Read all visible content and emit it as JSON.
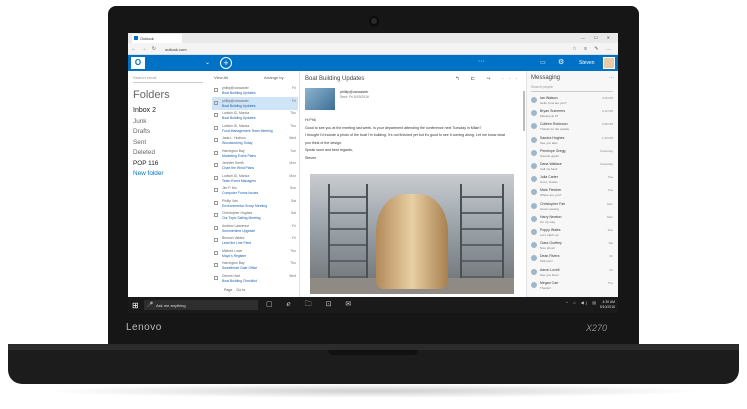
{
  "device": {
    "brand": "Lenovo",
    "model": "X270"
  },
  "browser": {
    "tab_title": "Outlook",
    "url": "outlook.com",
    "nav_icons": "← → ↻",
    "tool_icons": "☆ ≡ ✎ …",
    "window_controls": "— ☐ ✕"
  },
  "outlook": {
    "logo_letter": "O",
    "new_icon": "+",
    "header_more": "···",
    "user_name": "Steven",
    "accent_color": "#0072c6"
  },
  "folders": {
    "search_placeholder": "Search email",
    "heading": "Folders",
    "items": [
      {
        "label": "Inbox  2"
      },
      {
        "label": "Junk"
      },
      {
        "label": "Drafts"
      },
      {
        "label": "Sent"
      },
      {
        "label": "Deleted"
      },
      {
        "label": "POP  116"
      },
      {
        "label": "New folder"
      }
    ]
  },
  "message_list": {
    "view_all": "View All",
    "arrange_by": "Arrange by",
    "rows": [
      {
        "sender": "phillip@vancaster",
        "subject": "Boat Building Updates",
        "date": "Fri"
      },
      {
        "sender": "phillip@vancaster",
        "subject": "Boat Building Updates",
        "date": "Fri"
      },
      {
        "sender": "Ludwin ID, Marcia",
        "subject": "Boat Building Updates",
        "date": "Thu"
      },
      {
        "sender": "Ludwin ID, Marcia",
        "subject": "Fund Management Team Meeting",
        "date": "Thu"
      },
      {
        "sender": "Jada L. Hudson",
        "subject": "Woodworking Today",
        "date": "Wed"
      },
      {
        "sender": "Harrington Bay",
        "subject": "Marketing Event Plans",
        "date": "Tue"
      },
      {
        "sender": "Jennifer Smith",
        "subject": "Chart the Wind Plans",
        "date": "Mon"
      },
      {
        "sender": "Ludwin ID, Marcia",
        "subject": "Team Event Managers",
        "date": "Mon"
      },
      {
        "sender": "Jim P. Mo",
        "subject": "Computer Forms Issues",
        "date": "Sun"
      },
      {
        "sender": "Phillip Van",
        "subject": "Environmental Group Meeting",
        "date": "Sat"
      },
      {
        "sender": "Christopher Hughes",
        "subject": "Our Topic Sailing Meeting",
        "date": "Sat"
      },
      {
        "sender": "Andrew Lawrence",
        "subject": "Summertime Upgrade",
        "date": "Fri"
      },
      {
        "sender": "Benson Valdez",
        "subject": "Lead the Line Fleet",
        "date": "Fri"
      },
      {
        "sender": "Mildred Lowe",
        "subject": "Mayo's Register",
        "date": "Thu"
      },
      {
        "sender": "Harrington Bay",
        "subject": "Sweetheart Gate Office",
        "date": "Thu"
      },
      {
        "sender": "Dennis Hart",
        "subject": "Boat Building Checklist",
        "date": "Wed"
      }
    ],
    "pager_page": "Page",
    "pager_goto": "Go to"
  },
  "reading_pane": {
    "subject": "Boat Building Updates",
    "actions": "↰ ⇇ ↪ ···",
    "sender_name": "phillip@vancaster",
    "sender_sub": "Sent: Fri 5/19/2016",
    "greeting": "Hi Phil,",
    "paragraph1": "Good to see you at the meeting last week. Is your department attending the conference next Tuesday in Milan?",
    "paragraph2": "I thought I'd include a photo of the boat I'm building. It's not finished yet but it's good to see it coming along. Let me know what you think of the design.",
    "closing": "Speak soon and best regards,",
    "signature": "Steven"
  },
  "messaging": {
    "title": "Messaging",
    "more": "···",
    "search_placeholder": "Search people",
    "contacts": [
      {
        "name": "Ian Watson",
        "preview": "Hello, how are you?",
        "time": "3:46 PM"
      },
      {
        "name": "Bryan Summers",
        "preview": "Meeting at 4?",
        "time": "3:12 PM"
      },
      {
        "name": "Colleen Robinson",
        "preview": "Thanks for the update",
        "time": "2:58 PM"
      },
      {
        "name": "Sandra Hughes",
        "preview": "See you later",
        "time": "1:30 PM"
      },
      {
        "name": "Penelope Gregg",
        "preview": "Sounds great!",
        "time": "Yesterday"
      },
      {
        "name": "Dana Wallace",
        "preview": "Call me back",
        "time": "Yesterday"
      },
      {
        "name": "Julia Carter",
        "preview": "Got it, thanks",
        "time": "Tue"
      },
      {
        "name": "Mark Fletcher",
        "preview": "Where are you?",
        "time": "Tue"
      },
      {
        "name": "Christopher Fair",
        "preview": "Great meeting",
        "time": "Mon"
      },
      {
        "name": "Harry Newton",
        "preview": "On my way",
        "time": "Mon"
      },
      {
        "name": "Poppy Wales",
        "preview": "Let's catch up",
        "time": "Sun"
      },
      {
        "name": "Clara Godfrey",
        "preview": "Nice photo!",
        "time": "Sat"
      },
      {
        "name": "Dean Rivera",
        "preview": "Talk soon",
        "time": "Fri"
      },
      {
        "name": "Aaron Lovell",
        "preview": "See you there",
        "time": "Fri"
      },
      {
        "name": "Megan Carr",
        "preview": "Thanks!",
        "time": "Thu"
      }
    ]
  },
  "taskbar": {
    "windows_icon": "⊞",
    "search_text": "Ask me anything",
    "mic_icon": "🎤",
    "apps_icons": "▢ ℯ 🗀 ⊡ ✉",
    "tray_icons": "^ ⌂ ◀) ▤",
    "time": "4:30 AM",
    "date": "5/10/2016"
  }
}
